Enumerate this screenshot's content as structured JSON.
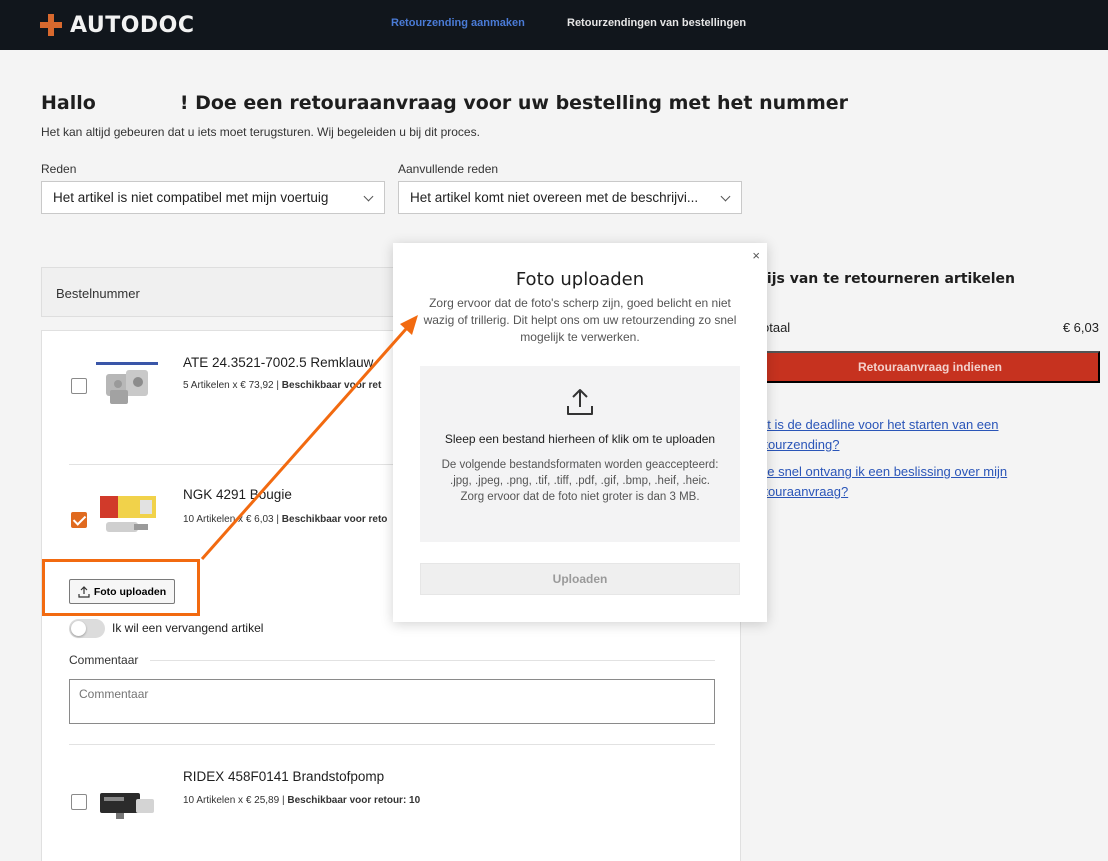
{
  "header": {
    "logo_text": "AUTODOC",
    "nav": [
      "Retourzending aanmaken",
      "Retourzendingen van bestellingen"
    ]
  },
  "page": {
    "greeting_pre": "Hallo",
    "greeting_post": "! Doe een retouraanvraag voor uw bestelling met het nummer",
    "subtitle": "Het kan altijd gebeuren dat u iets moet terugsturen. Wij begeleiden u bij dit proces."
  },
  "form": {
    "reason_label": "Reden",
    "reason_value": "Het artikel is niet compatibel met mijn voertuig",
    "extra_reason_label": "Aanvullende reden",
    "extra_reason_value": "Het artikel komt niet overeen met de beschrijvi..."
  },
  "order": {
    "number_label": "Bestelnummer"
  },
  "items": [
    {
      "name": "ATE 24.3521-7002.5 Remklauw",
      "meta_prefix": "5 Artikelen x € 73,92 |",
      "meta_bold": "Beschikbaar voor ret",
      "checked": false
    },
    {
      "name": "NGK 4291 Bougie",
      "meta_prefix": "10 Artikelen x € 6,03 |",
      "meta_bold": "Beschikbaar voor reto",
      "checked": true
    },
    {
      "name": "RIDEX 458F0141 Brandstofpomp",
      "meta_prefix": "10 Artikelen x € 25,89 |",
      "meta_bold": "Beschikbaar voor retour: 10",
      "checked": false
    }
  ],
  "item_controls": {
    "upload_label": "Foto uploaden",
    "replacement_label": "Ik wil een vervangend artikel",
    "comment_label": "Commentaar",
    "comment_placeholder": "Commentaar"
  },
  "summary": {
    "title": "rijs van te retourneren artikelen",
    "total_label": "otaal",
    "total_value": "€ 6,03",
    "submit_label": "Retouraanvraag indienen",
    "faq": [
      "at is de deadline voor het starten van een\nrtourzending?",
      "oe snel ontvang ik een beslissing over mijn\nrtouraanvraag?"
    ]
  },
  "modal": {
    "close": "×",
    "title": "Foto uploaden",
    "description": "Zorg ervoor dat de foto's scherp zijn, goed belicht en niet wazig of trillerig. Dit helpt ons om uw retourzending zo snel mogelijk te verwerken.",
    "dropzone_main": "Sleep een bestand hierheen of klik om te uploaden",
    "dropzone_formats": "De volgende bestandsformaten worden geaccepteerd: .jpg, .jpeg, .png, .tif, .tiff, .pdf, .gif, .bmp, .heif, .heic.",
    "dropzone_limit": "Zorg ervoor dat de foto niet groter is dan 3 MB.",
    "upload_button": "Uploaden"
  },
  "colors": {
    "accent_orange": "#e06a1f",
    "annotation": "#f26a10",
    "submit_red": "#c6321f",
    "link_blue": "#2a55b8",
    "header_bg": "#11161c"
  },
  "icons": [
    "logo-cross-icon",
    "chevron-down-icon",
    "upload-icon",
    "close-icon",
    "annotation-arrow"
  ]
}
